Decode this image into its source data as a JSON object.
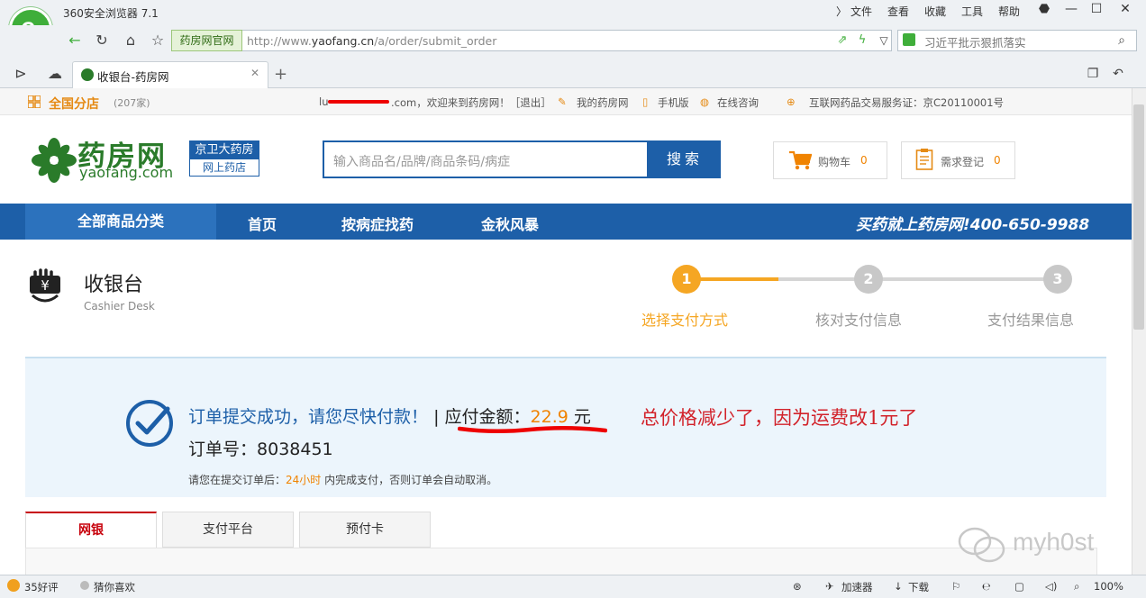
{
  "browser": {
    "app_title": "360安全浏览器 7.1",
    "menu": [
      "文件",
      "查看",
      "收藏",
      "工具",
      "帮助"
    ],
    "site_chip": "药房网官网",
    "url_prefix": "http://www.",
    "url_domain": "yaofang.cn",
    "url_path": "/a/order/submit_order",
    "search_placeholder": "习近平批示狠抓落实",
    "tab_title": "收银台-药房网"
  },
  "topbar": {
    "branch_label": "全国分店",
    "branch_count": "(207家)",
    "user_prefix": "lu",
    "user_suffix": ".com，欢迎来到药房网！［退出］",
    "links": [
      "我的药房网",
      "手机版",
      "在线咨询"
    ],
    "license": "互联网药品交易服务证：京C20110001号"
  },
  "header": {
    "logo_cn": "药房网",
    "logo_en": "yaofang.com",
    "jw_top": "京卫大药房",
    "jw_bottom": "网上药店",
    "search_placeholder": "输入商品名/品牌/商品条码/病症",
    "search_button": "搜索",
    "cart_label": "购物车",
    "cart_count": "0",
    "need_label": "需求登记",
    "need_count": "0"
  },
  "nav": {
    "all": "全部商品分类",
    "items": [
      "首页",
      "按病症找药",
      "金秋风暴"
    ],
    "slogan": "买药就上药房网!400-650-9988"
  },
  "cashier": {
    "title": "收银台",
    "subtitle": "Cashier Desk"
  },
  "steps": [
    {
      "num": "1",
      "label": "选择支付方式",
      "active": true
    },
    {
      "num": "2",
      "label": "核对支付信息",
      "active": false
    },
    {
      "num": "3",
      "label": "支付结果信息",
      "active": false
    }
  ],
  "order": {
    "success_text": "订单提交成功，请您尽快付款！",
    "sep": "|",
    "amount_label": "应付金额：",
    "amount": "22.9",
    "currency": "元",
    "order_no_label": "订单号：",
    "order_no": "8038451",
    "note_prefix": "请您在提交订单后：",
    "note_time": "24小时",
    "note_suffix": "内完成支付，否则订单会自动取消。",
    "annotation": "总价格减少了，因为运费改1元了"
  },
  "pay_tabs": [
    "网银",
    "支付平台",
    "预付卡"
  ],
  "watermark": "myh0st",
  "statusbar": {
    "left": [
      "35好评",
      "猜你喜欢"
    ],
    "right": [
      "加速器",
      "下载"
    ],
    "zoom": "100%"
  },
  "colors": {
    "brand_blue": "#1d5fa8",
    "orange": "#f08300",
    "annotation_red": "#d2222a",
    "green": "#2a7b2a"
  }
}
